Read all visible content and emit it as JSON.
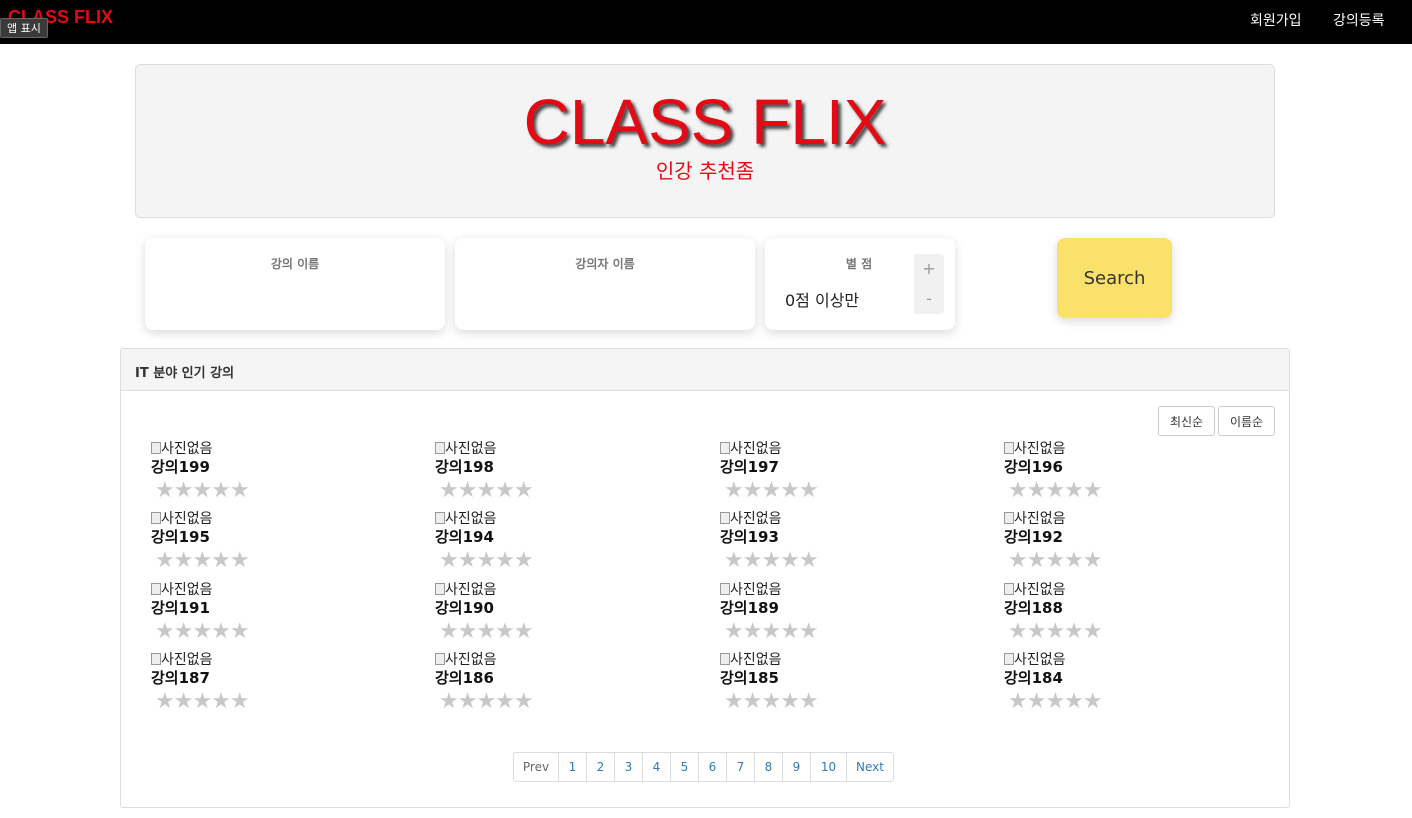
{
  "nav": {
    "brand": "CLASS FLIX",
    "app_badge": "앱 표시",
    "signup": "회원가입",
    "register": "강의등록"
  },
  "hero": {
    "title": "CLASS FLIX",
    "subtitle": "인강 추천좀"
  },
  "search": {
    "name_label": "강의 이름",
    "instructor_label": "강의자 이름",
    "rating_label": "별 점",
    "rating_value": "0점 이상만",
    "plus": "+",
    "minus": "-",
    "button": "Search"
  },
  "panel": {
    "title": "IT 분야 인기 강의",
    "sort_new": "최신순",
    "sort_name": "이름순"
  },
  "courses": [
    {
      "alt": "사진없음",
      "title": "강의199",
      "rating": 0
    },
    {
      "alt": "사진없음",
      "title": "강의198",
      "rating": 0
    },
    {
      "alt": "사진없음",
      "title": "강의197",
      "rating": 0
    },
    {
      "alt": "사진없음",
      "title": "강의196",
      "rating": 0
    },
    {
      "alt": "사진없음",
      "title": "강의195",
      "rating": 0
    },
    {
      "alt": "사진없음",
      "title": "강의194",
      "rating": 0
    },
    {
      "alt": "사진없음",
      "title": "강의193",
      "rating": 0
    },
    {
      "alt": "사진없음",
      "title": "강의192",
      "rating": 0
    },
    {
      "alt": "사진없음",
      "title": "강의191",
      "rating": 0
    },
    {
      "alt": "사진없음",
      "title": "강의190",
      "rating": 0
    },
    {
      "alt": "사진없음",
      "title": "강의189",
      "rating": 0
    },
    {
      "alt": "사진없음",
      "title": "강의188",
      "rating": 0
    },
    {
      "alt": "사진없음",
      "title": "강의187",
      "rating": 0
    },
    {
      "alt": "사진없음",
      "title": "강의186",
      "rating": 0
    },
    {
      "alt": "사진없음",
      "title": "강의185",
      "rating": 0
    },
    {
      "alt": "사진없음",
      "title": "강의184",
      "rating": 0
    }
  ],
  "stars": "★★★★★",
  "pagination": [
    "Prev",
    "1",
    "2",
    "3",
    "4",
    "5",
    "6",
    "7",
    "8",
    "9",
    "10",
    "Next"
  ]
}
